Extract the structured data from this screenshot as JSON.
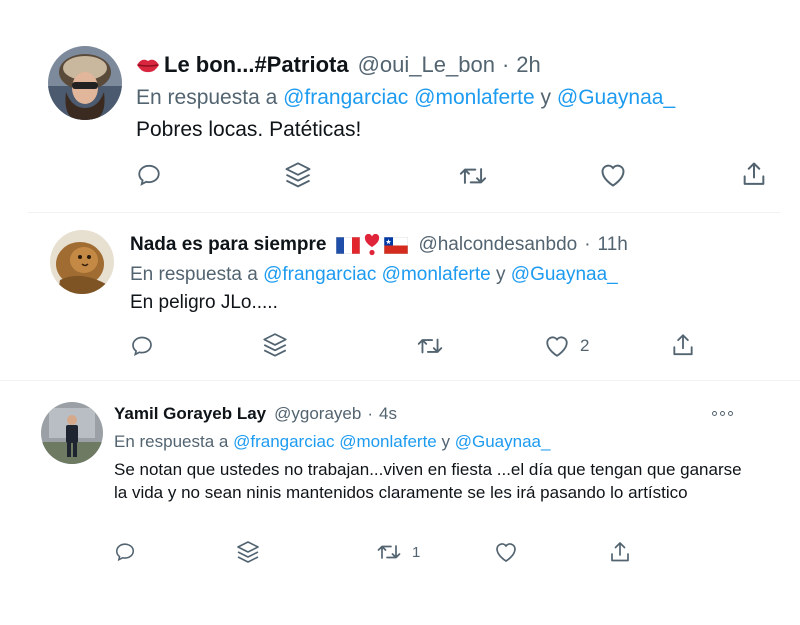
{
  "tweets": [
    {
      "name_prefix_icon": "kiss-lips-icon",
      "name": "Le bon...#Patriota",
      "handle": "@oui_Le_bon",
      "separator": "·",
      "time": "2h",
      "reply_prefix": "En respuesta a",
      "mention_1": "@frangarciac",
      "mention_2": "@monlaferte",
      "reply_conj": "y",
      "mention_3": "@Guaynaa_",
      "text": "Pobres locas. Patéticas!",
      "likes": ""
    },
    {
      "name": "Nada es para siempre",
      "name_emojis": [
        "france-flag-icon",
        "exclamation-heart-icon",
        "chile-flag-icon"
      ],
      "handle": "@halcondesanbdo",
      "separator": "·",
      "time": "11h",
      "reply_prefix": "En respuesta a",
      "mention_1": "@frangarciac",
      "mention_2": "@monlaferte",
      "reply_conj": "y",
      "mention_3": "@Guaynaa_",
      "text": "En peligro JLo.....",
      "likes": "2"
    },
    {
      "name": "Yamil Gorayeb Lay",
      "handle": "@ygorayeb",
      "separator": "·",
      "time": "4s",
      "reply_prefix": "En respuesta a",
      "mention_1": "@frangarciac",
      "mention_2": "@monlaferte",
      "reply_conj": "y",
      "mention_3": "@Guaynaa_",
      "text": "Se notan que ustedes no trabajan...viven en fiesta ...el día que tengan que ganarse la vida y no sean ninis mantenidos claramente se les irá pasando lo artístico",
      "retweets": "1"
    }
  ],
  "colors": {
    "link": "#1d9bf0",
    "secondary": "#536471",
    "primary_text": "#0f1419",
    "divider": "#eff3f4"
  },
  "icons": {
    "reply": "reply-icon",
    "stack": "layers-icon",
    "retweet": "retweet-icon",
    "like": "heart-icon",
    "share": "share-icon",
    "more": "more-icon"
  }
}
